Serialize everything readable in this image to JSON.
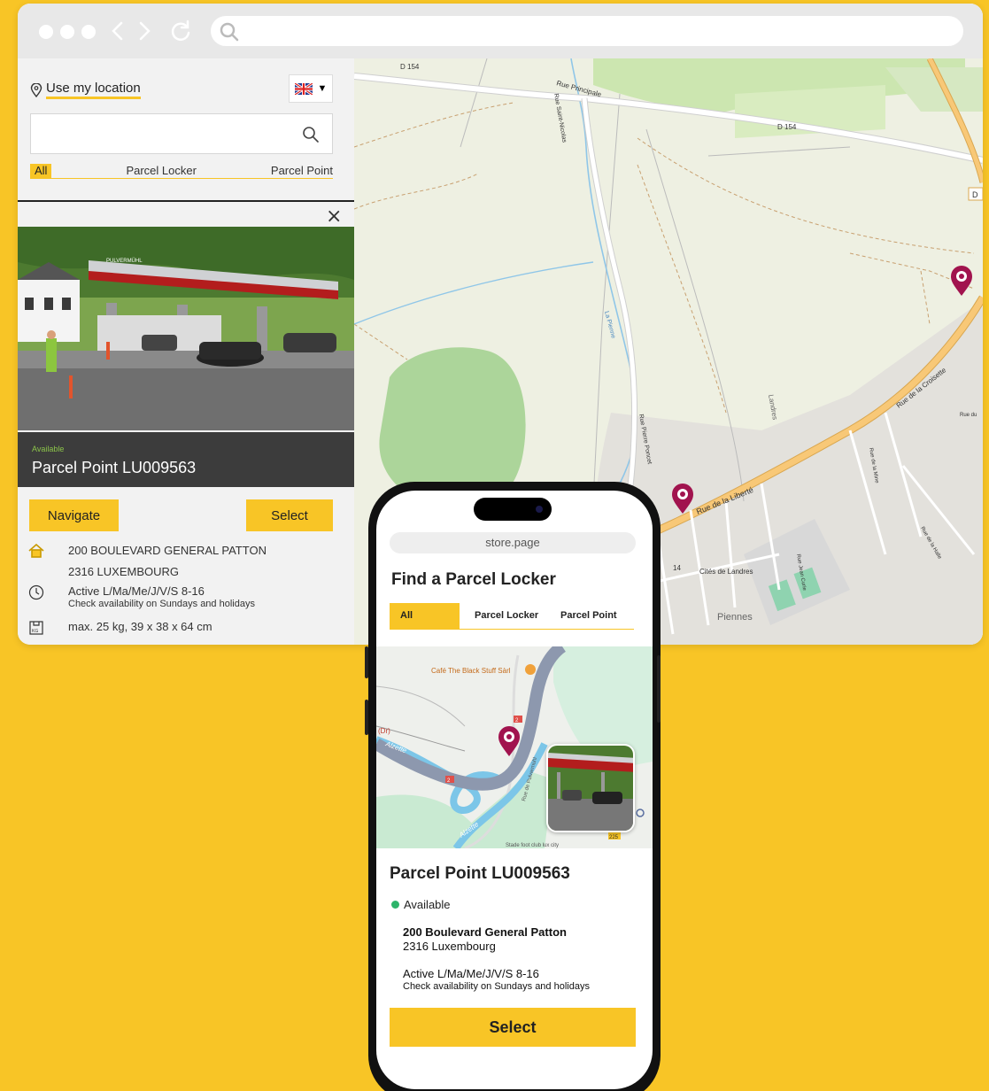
{
  "sidebar": {
    "use_location": "Use my location",
    "language_caret": "▼",
    "search_value": "",
    "filters": {
      "all": "All",
      "locker": "Parcel Locker",
      "point": "Parcel Point"
    },
    "close": "×",
    "status": "Available",
    "title": "Parcel Point LU009563",
    "photo_sign": "PULVERMÜHL",
    "navigate": "Navigate",
    "select": "Select",
    "address_line1": "200 BOULEVARD GENERAL PATTON",
    "address_line2": "2316 LUXEMBOURG",
    "hours": "Active L/Ma/Me/J/V/S 8-16",
    "hours_note": "Check availability on Sundays and holidays",
    "dims": "max. 25 kg, 39 x 38 x 64 cm"
  },
  "map": {
    "labels": {
      "d154_a": "D 154",
      "d154_b": "D 154",
      "rue_principale": "Rue Principale",
      "rue_saint_nicolas": "Rue Saint-Nicolas",
      "la_pienne": "La Pienne",
      "rue_croisette": "Rue de la Croisette",
      "rue_liberte": "Rue de la Liberté",
      "rue_pierre_poncet": "Rue Pierre Poncet",
      "landres": "Landres",
      "cites_landres": "Cités de Landres",
      "piennes": "Piennes",
      "rue_mine": "Rue de la Mine",
      "rue_halle": "Rue de la Halle",
      "rue_du": "Rue du",
      "rue_jean_curie": "Rue Jean Curie",
      "d_letter": "D",
      "d14": "14"
    }
  },
  "phone": {
    "url": "store.page",
    "heading": "Find a Parcel Locker",
    "tabs": {
      "all": "All",
      "locker": "Parcel Locker",
      "point": "Parcel Point"
    },
    "map_labels": {
      "cafe": "Café The Black Stuff Sàrl",
      "alzette_a": "Alzette",
      "alzette_b": "Alzette",
      "dr": "(Dr)",
      "rue_pulvermuhl": "Rue de Pulvermühl",
      "stade": "Stade foot club lux city",
      "r225": "225",
      "badge2a": "2",
      "badge2b": "2"
    },
    "title": "Parcel Point LU009563",
    "status": "Available",
    "address_line1": "200 Boulevard General Patton",
    "address_line2": "2316 Luxembourg",
    "hours": "Active L/Ma/Me/J/V/S 8-16",
    "hours_note": "Check availability on Sundays and holidays",
    "select": "Select"
  },
  "colors": {
    "accent": "#f8c526",
    "marker": "#a1134e",
    "available": "#2db46a"
  },
  "icons": [
    "location-pin-icon",
    "uk-flag-icon",
    "search-icon",
    "close-icon",
    "home-icon",
    "clock-icon",
    "weight-icon",
    "map-marker-icon",
    "back-icon",
    "forward-icon",
    "reload-icon"
  ]
}
